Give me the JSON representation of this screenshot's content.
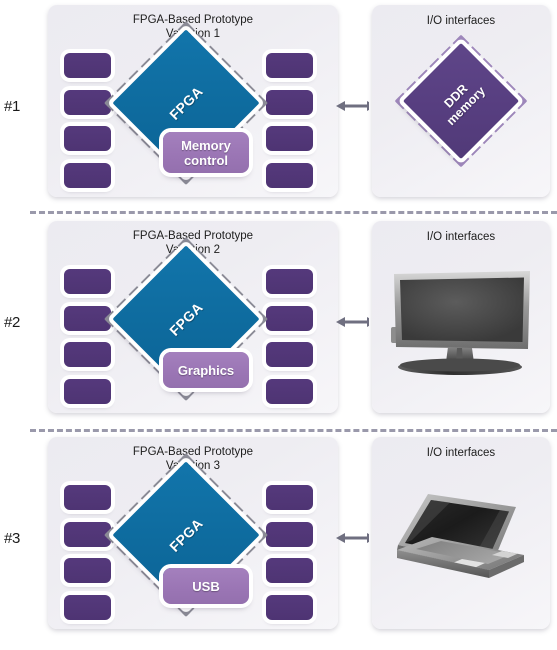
{
  "colors": {
    "background": "#ffffff",
    "panel_fill": "#eeedf2",
    "fpga_blue": "#0e6b9e",
    "port_purple": "#4e3473",
    "core_purple": "#9b76b5",
    "memory_purple": "#573e80",
    "pin_gray": "#8b8b96",
    "pin_purple": "#9e87bb",
    "arrow_gray": "#6f6f80",
    "divider_gray": "#9a99ab",
    "text_dark": "#1d1d1d"
  },
  "rows": [
    {
      "number_label": "#1",
      "prototype_panel": {
        "title": "FPGA-Based Prototype\nVariation 1",
        "chip_label": "FPGA",
        "core_label": "Memory\ncontrol",
        "core_two_line": true,
        "left_ports": [
          "port-l1",
          "port-l2",
          "port-l3",
          "port-l4"
        ],
        "right_ports": [
          "port-r1",
          "port-r2",
          "port-r3",
          "port-r4"
        ]
      },
      "connector": {
        "type": "double-arrow",
        "direction": "bidirectional"
      },
      "io_panel": {
        "title": "I/O interfaces",
        "device_type": "ddr-memory-diamond",
        "device_label": "DDR\nmemory"
      }
    },
    {
      "number_label": "#2",
      "prototype_panel": {
        "title": "FPGA-Based Prototype\nVariation 2",
        "chip_label": "FPGA",
        "core_label": "Graphics",
        "core_two_line": false,
        "left_ports": [
          "port-l1",
          "port-l2",
          "port-l3",
          "port-l4"
        ],
        "right_ports": [
          "port-r1",
          "port-r2",
          "port-r3",
          "port-r4"
        ]
      },
      "connector": {
        "type": "double-arrow",
        "direction": "bidirectional"
      },
      "io_panel": {
        "title": "I/O interfaces",
        "device_type": "monitor",
        "device_label": ""
      }
    },
    {
      "number_label": "#3",
      "prototype_panel": {
        "title": "FPGA-Based Prototype\nVariation 3",
        "chip_label": "FPGA",
        "core_label": "USB",
        "core_two_line": false,
        "left_ports": [
          "port-l1",
          "port-l2",
          "port-l3",
          "port-l4"
        ],
        "right_ports": [
          "port-r1",
          "port-r2",
          "port-r3",
          "port-r4"
        ]
      },
      "connector": {
        "type": "double-arrow",
        "direction": "bidirectional"
      },
      "io_panel": {
        "title": "I/O interfaces",
        "device_type": "laptop",
        "device_label": ""
      }
    }
  ]
}
